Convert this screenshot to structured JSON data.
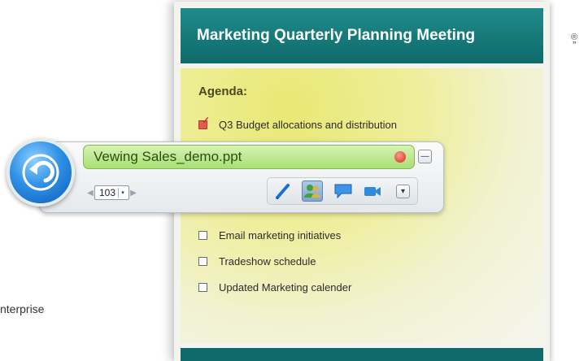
{
  "background_text": {
    "registered": "®",
    "comma": "”",
    "enterprise_fragment": "nterprise"
  },
  "slide": {
    "title": "Marketing Quarterly Planning Meeting",
    "agenda_label": "Agenda:",
    "items": [
      {
        "label": "Q3 Budget allocations and distribution",
        "checked": true
      },
      {
        "label": "Email marketing initiatives",
        "checked": false
      },
      {
        "label": "Tradeshow schedule",
        "checked": false
      },
      {
        "label": "Updated Marketing calender",
        "checked": false
      }
    ]
  },
  "toolbar": {
    "filename": "Vewing Sales_demo.ppt",
    "page_number": "103",
    "minimize_glyph": "—",
    "expand_glyph": "▾",
    "page_left_glyph": "◀",
    "page_right_glyph": "▶",
    "page_drop_glyph": "▾",
    "tools": [
      "pen-tool-icon",
      "contacts-icon",
      "chat-icon",
      "video-icon"
    ]
  },
  "colors": {
    "title_bar": "#0f6b6b",
    "filename_field": "#a9df74",
    "back_button": "#2e90e6",
    "record_dot": "#d2291a"
  }
}
